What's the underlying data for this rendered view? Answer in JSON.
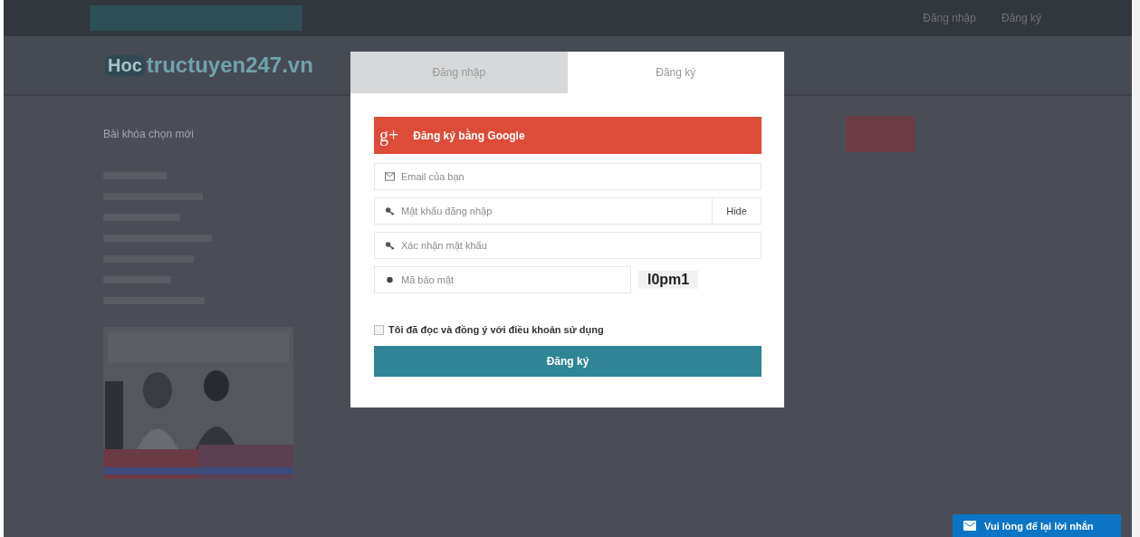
{
  "background": {
    "topbar_links": [
      "Đăng nhập",
      "Đăng ký"
    ],
    "logo": {
      "badge": "Hoc",
      "text": "tructuyen247.vn"
    },
    "sidebar_heading": "Bài khóa chọn mới"
  },
  "modal": {
    "tabs": [
      {
        "label": "Đăng nhập",
        "selected": false
      },
      {
        "label": "Đăng ký",
        "selected": true
      }
    ],
    "google_icon": "g+",
    "google_button": "Đăng ký bằng Google",
    "fields": [
      {
        "kind": "email",
        "placeholder": "Email của bạn"
      },
      {
        "kind": "key",
        "placeholder": "Mật khẩu đăng nhập",
        "toggle": "Hide"
      },
      {
        "kind": "key",
        "placeholder": "Xác nhận mật khẩu"
      },
      {
        "kind": "captcha",
        "placeholder": "Mã bảo mật",
        "code": "l0pm1"
      }
    ],
    "terms": {
      "label": "Tôi đã đọc và đồng ý với điều khoản sử dụng",
      "checked": false
    },
    "submit": "Đăng ký"
  },
  "chat_button": "Vui lòng để lại lời nhắn"
}
